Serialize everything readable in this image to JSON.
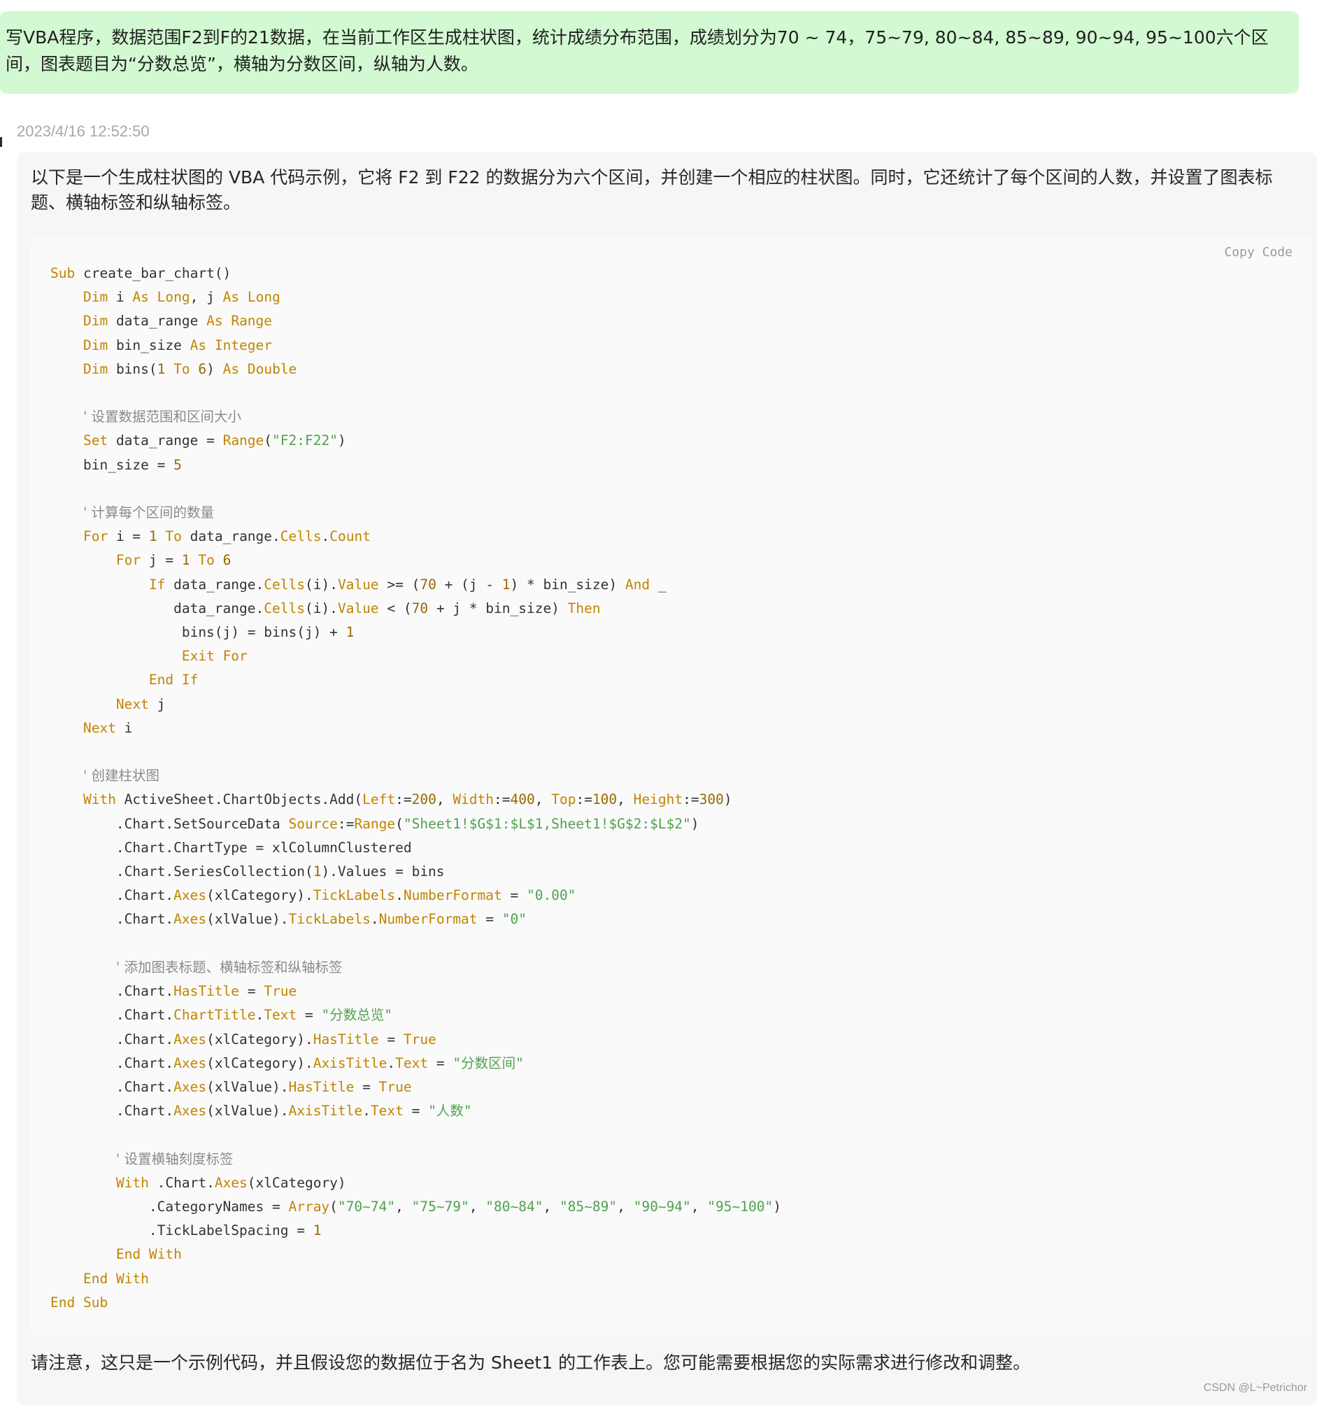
{
  "question": {
    "text": "写VBA程序，数据范围F2到F的21数据，在当前工作区生成柱状图，统计成绩分布范围，成绩划分为70 ~ 74，75~79, 80~84, 85~89, 90~94, 95~100六个区间，图表题目为“分数总览”，横轴为分数区间，纵轴为人数。"
  },
  "answer": {
    "timestamp": "2023/4/16 12:52:50",
    "intro": "以下是一个生成柱状图的 VBA 代码示例，它将 F2 到 F22 的数据分为六个区间，并创建一个相应的柱状图。同时，它还统计了每个区间的人数，并设置了图表标题、横轴标签和纵轴标签。",
    "copy_label": "Copy Code",
    "code_lines": [
      "Sub create_bar_chart()",
      "    Dim i As Long, j As Long",
      "    Dim data_range As Range",
      "    Dim bin_size As Integer",
      "    Dim bins(1 To 6) As Double",
      "",
      "    ' 设置数据范围和区间大小",
      "    Set data_range = Range(\"F2:F22\")",
      "    bin_size = 5",
      "",
      "    ' 计算每个区间的数量",
      "    For i = 1 To data_range.Cells.Count",
      "        For j = 1 To 6",
      "            If data_range.Cells(i).Value >= (70 + (j - 1) * bin_size) And _",
      "               data_range.Cells(i).Value < (70 + j * bin_size) Then",
      "                bins(j) = bins(j) + 1",
      "                Exit For",
      "            End If",
      "        Next j",
      "    Next i",
      "",
      "    ' 创建柱状图",
      "    With ActiveSheet.ChartObjects.Add(Left:=200, Width:=400, Top:=100, Height:=300)",
      "        .Chart.SetSourceData Source:=Range(\"Sheet1!$G$1:$L$1,Sheet1!$G$2:$L$2\")",
      "        .Chart.ChartType = xlColumnClustered",
      "        .Chart.SeriesCollection(1).Values = bins",
      "        .Chart.Axes(xlCategory).TickLabels.NumberFormat = \"0.00\"",
      "        .Chart.Axes(xlValue).TickLabels.NumberFormat = \"0\"",
      "",
      "        ' 添加图表标题、横轴标签和纵轴标签",
      "        .Chart.HasTitle = True",
      "        .Chart.ChartTitle.Text = \"分数总览\"",
      "        .Chart.Axes(xlCategory).HasTitle = True",
      "        .Chart.Axes(xlCategory).AxisTitle.Text = \"分数区间\"",
      "        .Chart.Axes(xlValue).HasTitle = True",
      "        .Chart.Axes(xlValue).AxisTitle.Text = \"人数\"",
      "",
      "        ' 设置横轴刻度标签",
      "        With .Chart.Axes(xlCategory)",
      "            .CategoryNames = Array(\"70~74\", \"75~79\", \"80~84\", \"85~89\", \"90~94\", \"95~100\")",
      "            .TickLabelSpacing = 1",
      "        End With",
      "    End With",
      "End Sub"
    ],
    "outro": "请注意，这只是一个示例代码，并且假设您的数据位于名为 Sheet1 的工作表上。您可能需要根据您的实际需求进行修改和调整。"
  },
  "watermark": "CSDN @L~Petrichor",
  "colors": {
    "question_bg": "#d2f9d1",
    "answer_bg": "#f4f6f8",
    "code_bg": "#fafafa",
    "keyword": "#c18401",
    "string": "#50a14f",
    "number": "#986801",
    "comment": "#8a8a8a"
  }
}
